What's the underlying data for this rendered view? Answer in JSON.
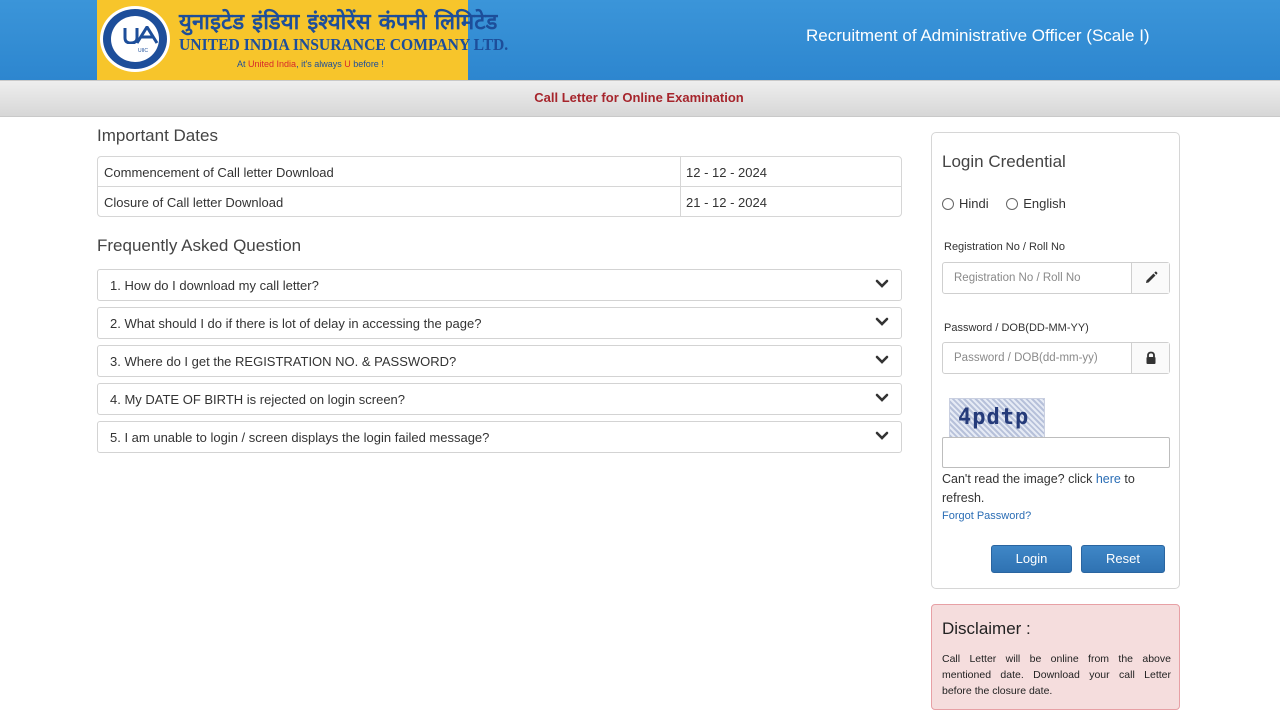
{
  "header": {
    "logo_hindi": "युनाइटेड इंडिया इंश्योरेंस कंपनी लिमिटेड",
    "logo_english": "UNITED INDIA INSURANCE COMPANY LTD.",
    "tagline_prefix": "At ",
    "tagline_highlight": "United India",
    "tagline_middle": ", it's always ",
    "tagline_u": "U",
    "tagline_suffix": " before !",
    "emblem_text": "UIIC",
    "title": "Recruitment of Administrative Officer (Scale I)",
    "colors": {
      "bar": "#2d86cf",
      "logo_bg": "#f7c52b",
      "logo_text": "#1d4e9a"
    }
  },
  "subbar": {
    "title": "Call Letter for Online Examination",
    "color": "#a6252c"
  },
  "important_dates": {
    "heading": "Important Dates",
    "rows": [
      {
        "label": "Commencement of Call letter Download",
        "date": "12 - 12 - 2024"
      },
      {
        "label": "Closure of Call letter Download",
        "date": "21 - 12 - 2024"
      }
    ]
  },
  "faq": {
    "heading": "Frequently Asked Question",
    "items": [
      "1. How do I download my call letter?",
      "2. What should I do if there is lot of delay in accessing the page?",
      "3. Where do I get the REGISTRATION NO. & PASSWORD?",
      "4. My DATE OF BIRTH is rejected on login screen?",
      "5. I am unable to login / screen displays the login failed message?"
    ],
    "icon": "chevron-down-icon"
  },
  "login": {
    "title": "Login Credential",
    "languages": [
      "Hindi",
      "English"
    ],
    "registration_label": "Registration No / Roll No",
    "registration_placeholder": "Registration No / Roll No",
    "registration_icon": "pencil-icon",
    "password_label": "Password / DOB(DD-MM-YY)",
    "password_placeholder": "Password / DOB(dd-mm-yy)",
    "password_icon": "lock-icon",
    "captcha_text": "4pdtp",
    "captcha_help_prefix": "Can't read the image? click ",
    "captcha_help_link": "here",
    "captcha_help_suffix": " to refresh.",
    "forgot_password": "Forgot Password?",
    "login_button": "Login",
    "reset_button": "Reset",
    "button_color": "#3479bb"
  },
  "disclaimer": {
    "title": "Disclaimer :",
    "body": "Call Letter will be online from the above mentioned date. Download your call Letter before the closure date.",
    "bg_color": "#f5dddd",
    "border_color": "#e7a0a5"
  }
}
